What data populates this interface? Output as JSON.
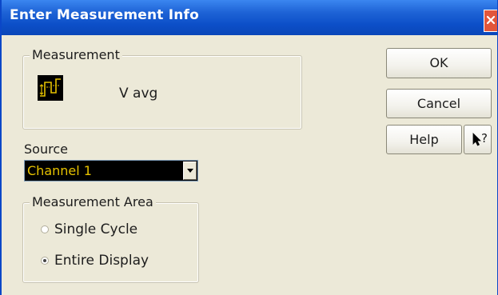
{
  "window": {
    "title": "Enter Measurement Info",
    "close_icon": "close-icon",
    "accent_color": "#0c4fc8"
  },
  "measurement": {
    "group_label": "Measurement",
    "icon": "waveform-measurement-icon",
    "name": "V avg"
  },
  "source": {
    "label": "Source",
    "selected_value": "Channel 1",
    "dropdown_icon": "chevron-down-icon"
  },
  "measurement_area": {
    "group_label": "Measurement Area",
    "options": [
      {
        "label": "Single Cycle",
        "checked": false
      },
      {
        "label": "Entire Display",
        "checked": true
      }
    ]
  },
  "buttons": {
    "ok": "OK",
    "cancel": "Cancel",
    "help": "Help",
    "whats_this": "?",
    "whats_this_icon": "pointer-question-icon"
  }
}
